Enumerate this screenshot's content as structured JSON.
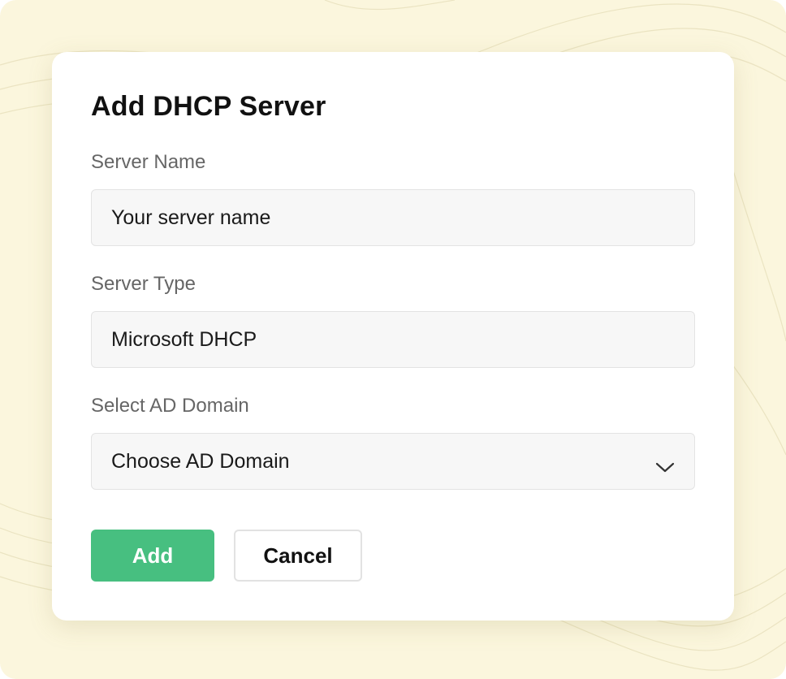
{
  "dialog": {
    "title": "Add DHCP Server",
    "fields": [
      {
        "label": "Server Name",
        "value": "Your server name"
      },
      {
        "label": "Server Type",
        "value": "Microsoft DHCP"
      },
      {
        "label": "Select AD Domain",
        "value": "Choose AD Domain"
      }
    ],
    "buttons": {
      "add": "Add",
      "cancel": "Cancel"
    }
  },
  "icons": {
    "dropdown": "chevron-down-icon"
  },
  "colors": {
    "backdrop": "#fbf6dd",
    "primary": "#47bf80",
    "field_bg": "#f7f7f7",
    "label": "#666666"
  }
}
